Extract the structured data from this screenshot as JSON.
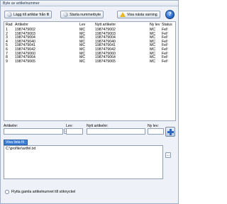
{
  "window": {
    "title": "Byte av artikelnummer"
  },
  "toolbar": {
    "add_label": "Lägg till artiklar från fil",
    "start_label": "Starta nummerbyte",
    "warning_label": "Visa nästa varning",
    "help_glyph": "?"
  },
  "grid": {
    "columns": {
      "rad": "Rad",
      "artikelnr": "Artikelnr",
      "lev": "Lev",
      "nytt": "Nytt artikelnr",
      "nylev": "Ny lev",
      "status": "Status"
    },
    "rows": [
      {
        "rad": "1",
        "artikelnr": "1987479002",
        "lev": "MC",
        "nytt": "1987479002",
        "nylev": "MC",
        "status": "Fel!"
      },
      {
        "rad": "2",
        "artikelnr": "1987479003",
        "lev": "MC",
        "nytt": "1987479003",
        "nylev": "MC",
        "status": "Fel!"
      },
      {
        "rad": "3",
        "artikelnr": "1987479004",
        "lev": "MC",
        "nytt": "1987479004",
        "nylev": "MC",
        "status": "Fel!"
      },
      {
        "rad": "4",
        "artikelnr": "1987479040",
        "lev": "MC",
        "nytt": "1987479040",
        "nylev": "MC",
        "status": "Fel!"
      },
      {
        "rad": "5",
        "artikelnr": "1987479041",
        "lev": "MC",
        "nytt": "1987479041",
        "nylev": "MC",
        "status": "Fel!"
      },
      {
        "rad": "6",
        "artikelnr": "1987479042",
        "lev": "MC",
        "nytt": "1987479042",
        "nylev": "MC",
        "status": "Fel!"
      },
      {
        "rad": "7",
        "artikelnr": "1987479060",
        "lev": "MC",
        "nytt": "1987479060",
        "nylev": "MC",
        "status": "Fel!"
      },
      {
        "rad": "8",
        "artikelnr": "1987479064",
        "lev": "MC",
        "nytt": "1987479064",
        "nylev": "MC",
        "status": "Fel!"
      },
      {
        "rad": "9",
        "artikelnr": "1987479065",
        "lev": "MC",
        "nytt": "1987479065",
        "nylev": "MC",
        "status": "Fel!"
      }
    ]
  },
  "form": {
    "artikelnr_label": "Artikelnr:",
    "lev_label": "Lev:",
    "nytt_label": "Nytt artikelnr:",
    "nylev_label": "Ny lev:",
    "source_select": "Visa lista fil",
    "file_path": "C:\\profiler\\artfel.txt",
    "lookup_button": "...",
    "lev_lookup_button": "..."
  },
  "footer": {
    "move_old_label": "Flytta gamla artikelnumret till söknyckel"
  },
  "colors": {
    "accent": "#3d7fd9",
    "warning": "#e8b81e",
    "help": "#2a68c8"
  }
}
